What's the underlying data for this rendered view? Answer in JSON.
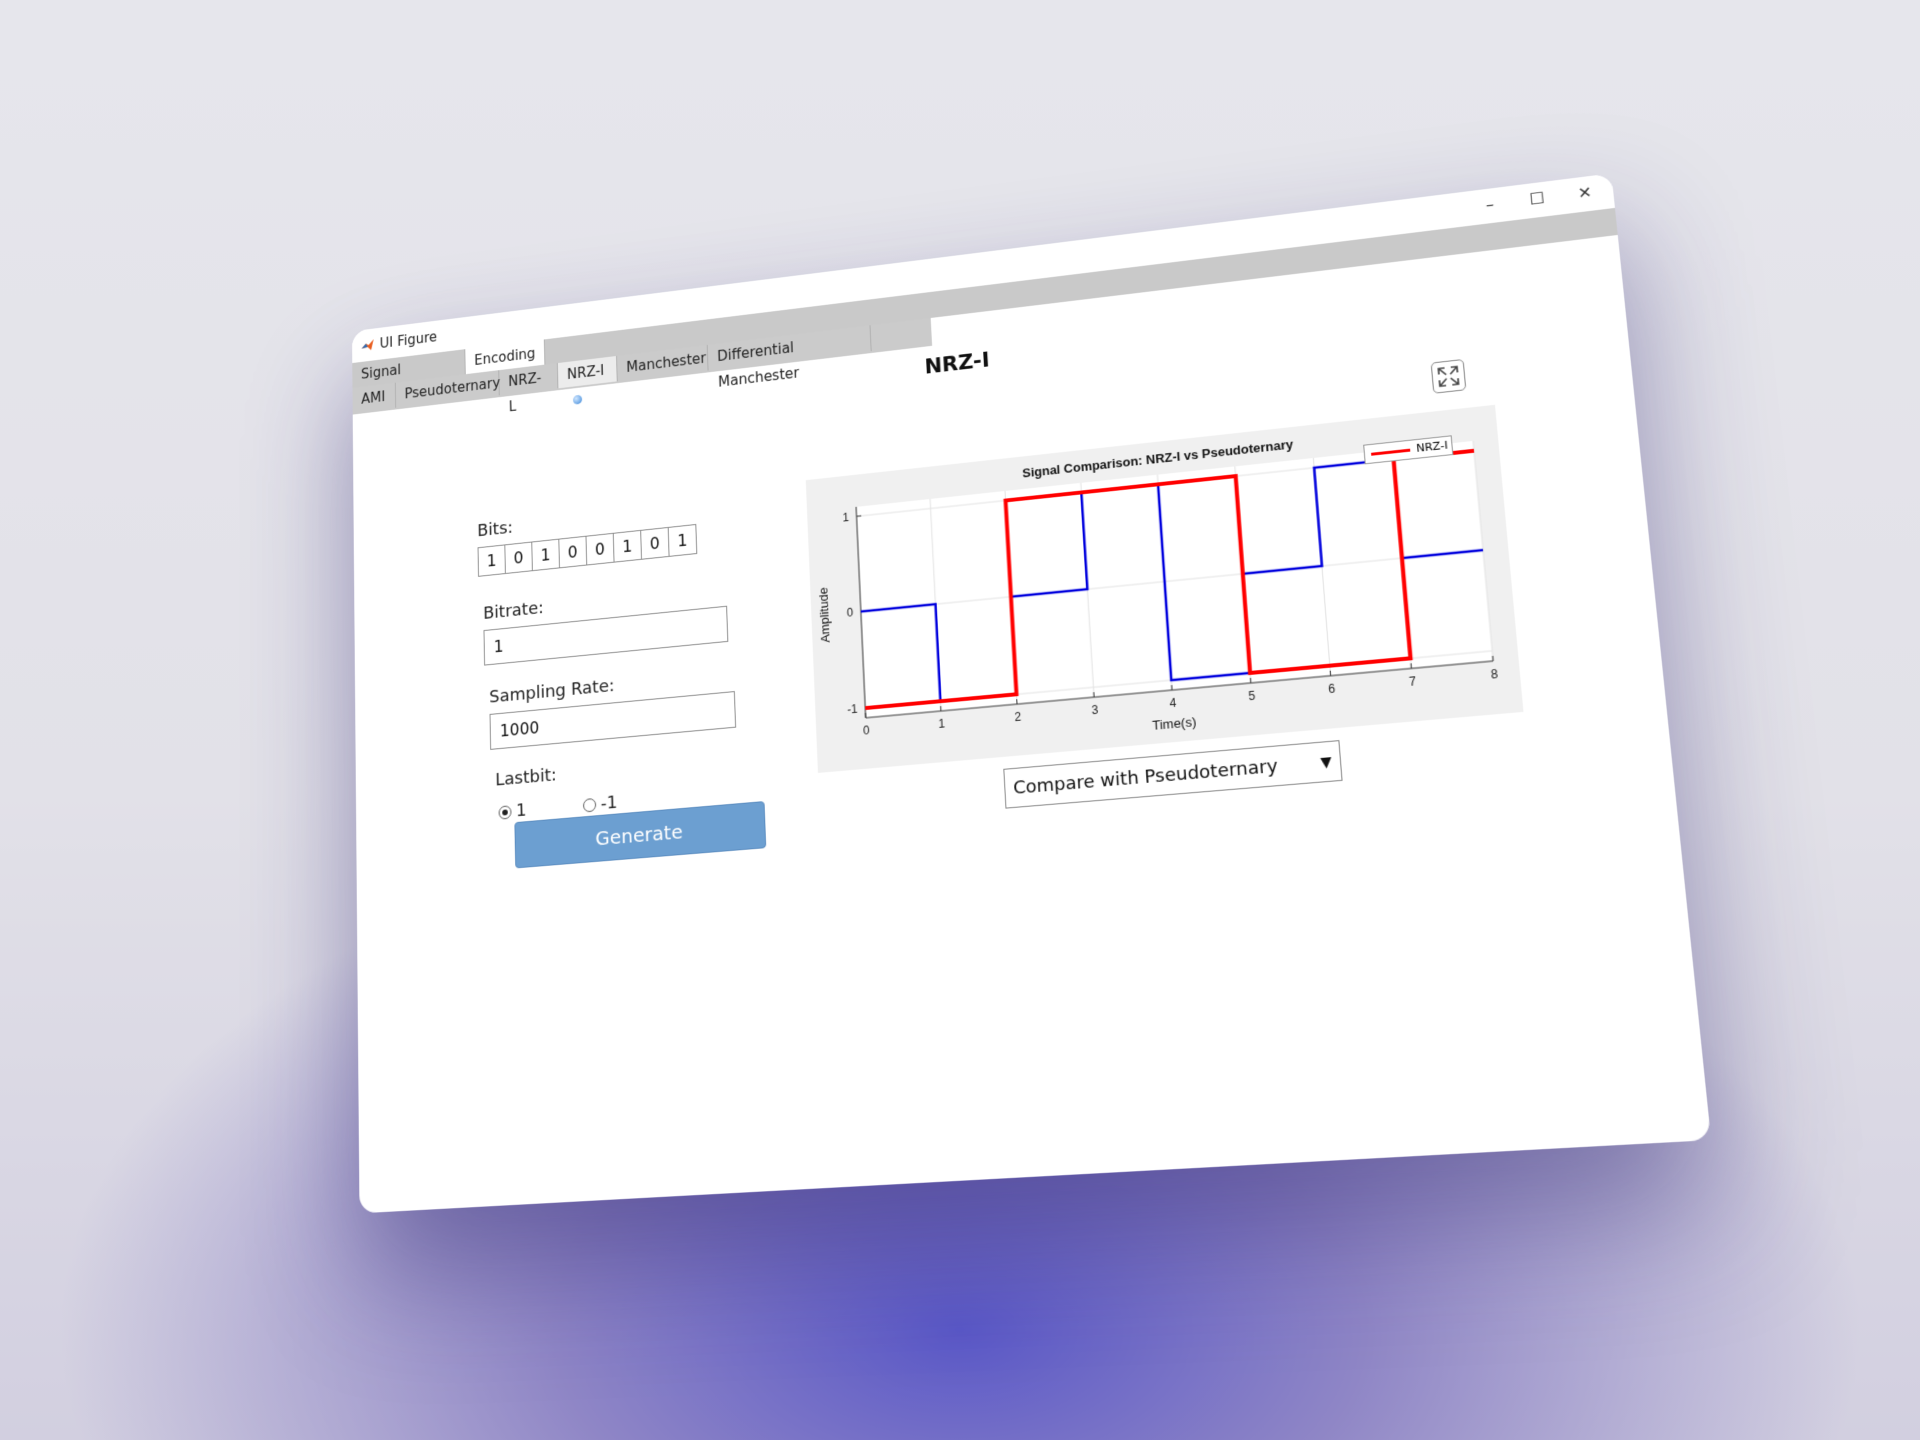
{
  "window": {
    "title": "UI Figure",
    "controls": {
      "minimize": "–",
      "maximize": "☐",
      "close": "✕"
    }
  },
  "tabs_top": [
    {
      "label": "Signal Conversion",
      "active": false
    },
    {
      "label": "Encoding",
      "active": true,
      "indicator": true
    }
  ],
  "tabs_sub": [
    {
      "label": "AMI",
      "active": false
    },
    {
      "label": "Pseudoternary",
      "active": false
    },
    {
      "label": "NRZ-L",
      "active": false
    },
    {
      "label": "NRZ-I",
      "active": true,
      "indicator": true
    },
    {
      "label": "Manchester",
      "active": false
    },
    {
      "label": "Differential Manchester",
      "active": false
    }
  ],
  "page": {
    "title": "NRZ-I"
  },
  "form": {
    "bits_label": "Bits:",
    "bits": [
      "1",
      "0",
      "1",
      "0",
      "0",
      "1",
      "0",
      "1"
    ],
    "bitrate_label": "Bitrate:",
    "bitrate_value": "1",
    "sampling_label": "Sampling Rate:",
    "sampling_value": "1000",
    "lastbit_label": "Lastbit:",
    "lastbit_options": [
      "1",
      "-1"
    ],
    "lastbit_selected": "1",
    "generate_label": "Generate"
  },
  "compare_dropdown": {
    "selected": "Compare with Pseudoternary",
    "arrow": "▼"
  },
  "chart_data": {
    "type": "line",
    "title": "Signal Comparison: NRZ-I vs Pseudoternary",
    "xlabel": "Time(s)",
    "ylabel": "Amplitude",
    "xlim": [
      0,
      8
    ],
    "ylim": [
      -1,
      1
    ],
    "xticks": [
      "0",
      "1",
      "2",
      "3",
      "4",
      "5",
      "6",
      "7",
      "8"
    ],
    "yticks": [
      "-1",
      "0",
      "1"
    ],
    "grid": true,
    "legend_position": "top-right",
    "series": [
      {
        "name": "NRZ-I",
        "color": "#ff0000",
        "x": [
          0,
          1,
          2,
          3,
          4,
          5,
          6,
          7,
          8
        ],
        "y": [
          -1,
          -1,
          1,
          1,
          1,
          -1,
          -1,
          1,
          1
        ]
      },
      {
        "color": "#0000dd",
        "x": [
          0,
          1,
          2,
          3,
          4,
          5,
          6,
          7,
          8
        ],
        "y": [
          0,
          -1,
          0,
          1,
          -1,
          0,
          1,
          0,
          0
        ]
      }
    ]
  }
}
